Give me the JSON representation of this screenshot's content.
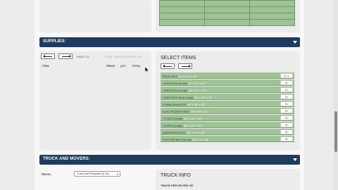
{
  "supplies": {
    "section_title": "SUPPLIES:",
    "page_label": "PAGE 1/1",
    "total_label": "TOTAL SUPPLIES PRICE: $0",
    "columns": {
      "item": "ITEM",
      "price": "PRICE",
      "qty": "QTY",
      "total": "TOTAL"
    }
  },
  "select_items": {
    "heading": "SELECT ITEMS",
    "items": [
      {
        "name": "BOOK BOX",
        "dims": "12\" x 12\" x 16\"",
        "price": "$0.0"
      },
      {
        "name": "LINEN BOX (Small)",
        "dims": "17\" x 17\" x 17\"",
        "price": "$0"
      },
      {
        "name": "LINEN BOX (Large)",
        "dims": "18\" x 18\" x 24\"",
        "price": "$0"
      },
      {
        "name": "LINEN BOX (Xtra Large)",
        "dims": "24\" x 18\" x 24\"",
        "price": "$0"
      },
      {
        "name": "CHINA (Dish) BOX",
        "dims": "18\" x 18\" x 28\"",
        "price": "$0"
      },
      {
        "name": "ELECTRONICS BOX",
        "dims": "18\" x 20\" x 12\"",
        "price": "$0"
      },
      {
        "name": "TV BOX (Small)",
        "dims": "36\" x 40\" x 20\"",
        "price": "$0"
      },
      {
        "name": "TV BOX (Large)",
        "dims": "38\" x 18\" x 37\"",
        "price": "$0"
      },
      {
        "name": "WARDROBE BOX",
        "dims": "24\" x 21\" x 46\"",
        "price": "$0"
      },
      {
        "name": "PICTURE BOX (Small)",
        "dims": "30\" x 5\" x 36\"",
        "price": "$0"
      }
    ]
  },
  "truck_movers": {
    "section_title": "TRUCK AND MOVERS:",
    "truck_label": "TRUCK:",
    "truck_select_value": "Truck Not Required (0 x0)",
    "info_heading": "TRUCK INFO",
    "fee_label": "TRUCK PER HR FEE: $0"
  },
  "icons": {
    "collapse": "chevron-down-icon",
    "prev": "arrow-left-icon",
    "next": "arrow-right-icon"
  },
  "colors": {
    "section_bar": "#1f3b5e",
    "item_green": "#9fc396"
  }
}
